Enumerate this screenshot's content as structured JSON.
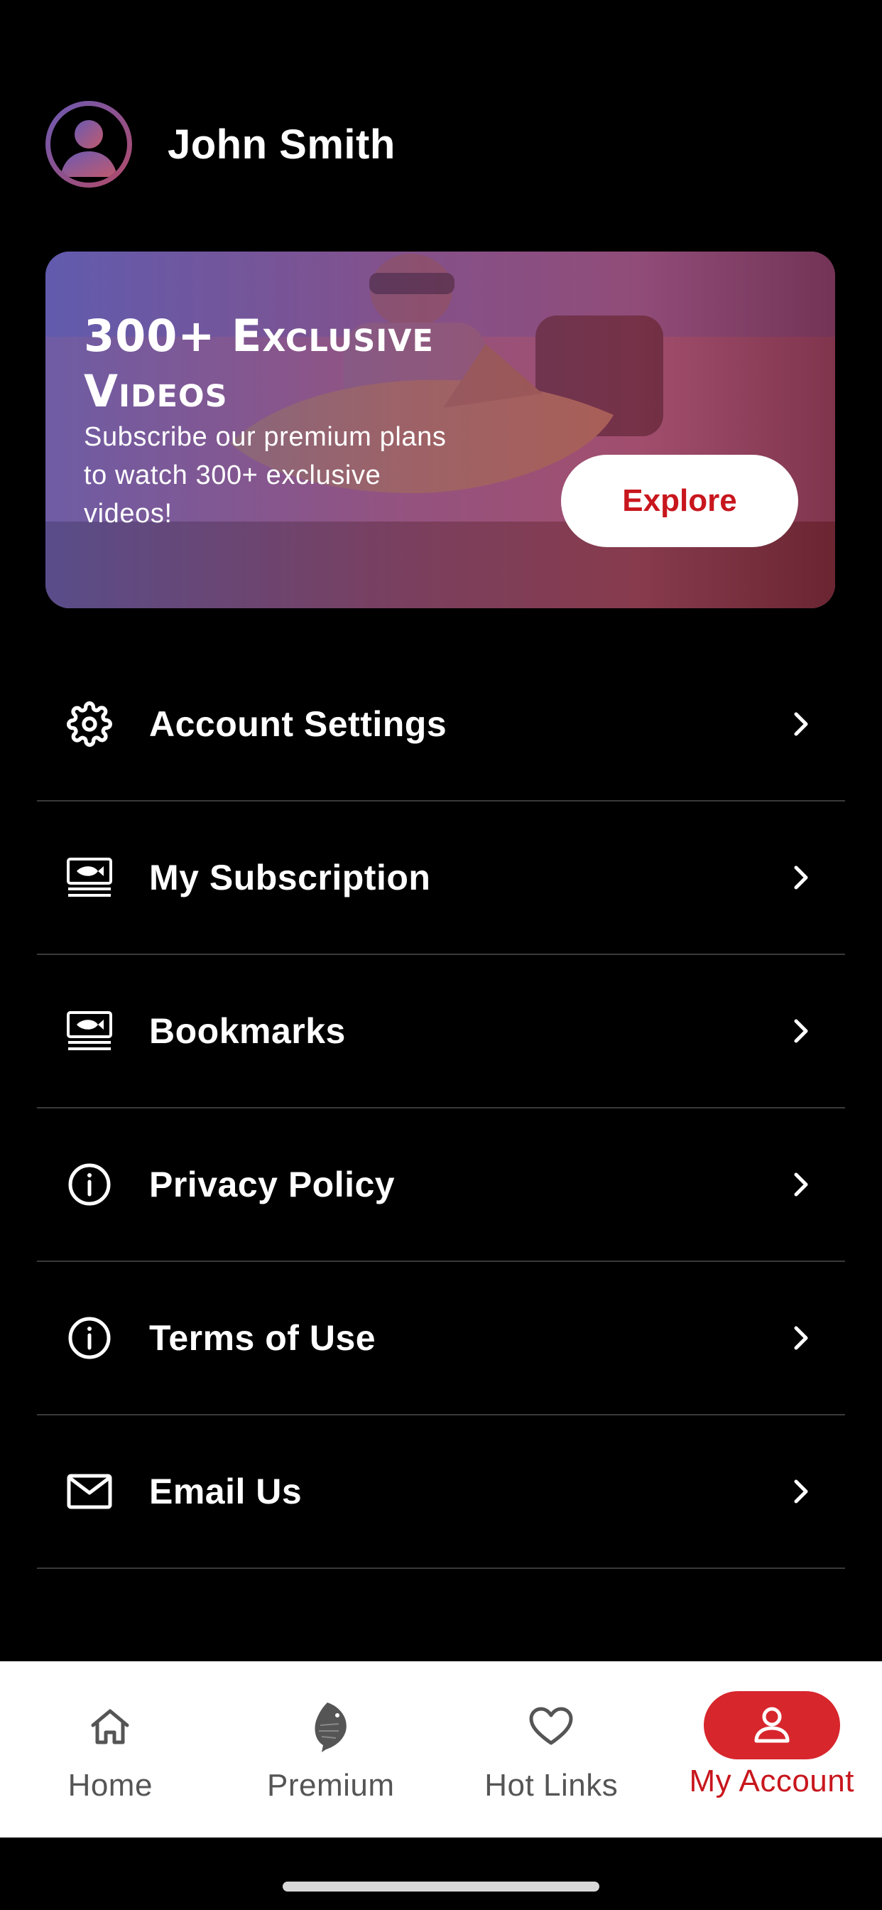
{
  "profile": {
    "name": "John Smith",
    "avatar_icon": "user-avatar-icon"
  },
  "banner": {
    "title_line1": "300+ Exclusive",
    "title_line2": "Videos",
    "subtitle": "Subscribe our premium plans to watch 300+ exclusive videos!",
    "button_label": "Explore"
  },
  "menu": {
    "items": [
      {
        "label": "Account Settings",
        "icon": "gear-icon"
      },
      {
        "label": "My Subscription",
        "icon": "subscription-icon"
      },
      {
        "label": "Bookmarks",
        "icon": "bookmark-icon"
      },
      {
        "label": "Privacy Policy",
        "icon": "info-icon"
      },
      {
        "label": "Terms of Use",
        "icon": "info-icon"
      },
      {
        "label": "Email Us",
        "icon": "mail-icon"
      }
    ]
  },
  "tabbar": {
    "tabs": [
      {
        "label": "Home",
        "icon": "home-icon",
        "active": false
      },
      {
        "label": "Premium",
        "icon": "fish-icon",
        "active": false
      },
      {
        "label": "Hot Links",
        "icon": "heart-icon",
        "active": false
      },
      {
        "label": "My Account",
        "icon": "person-icon",
        "active": true
      }
    ]
  },
  "colors": {
    "background": "#000000",
    "accent": "#c8161d",
    "active_tab_pill": "#d7262c",
    "tabbar_bg": "#ffffff"
  }
}
